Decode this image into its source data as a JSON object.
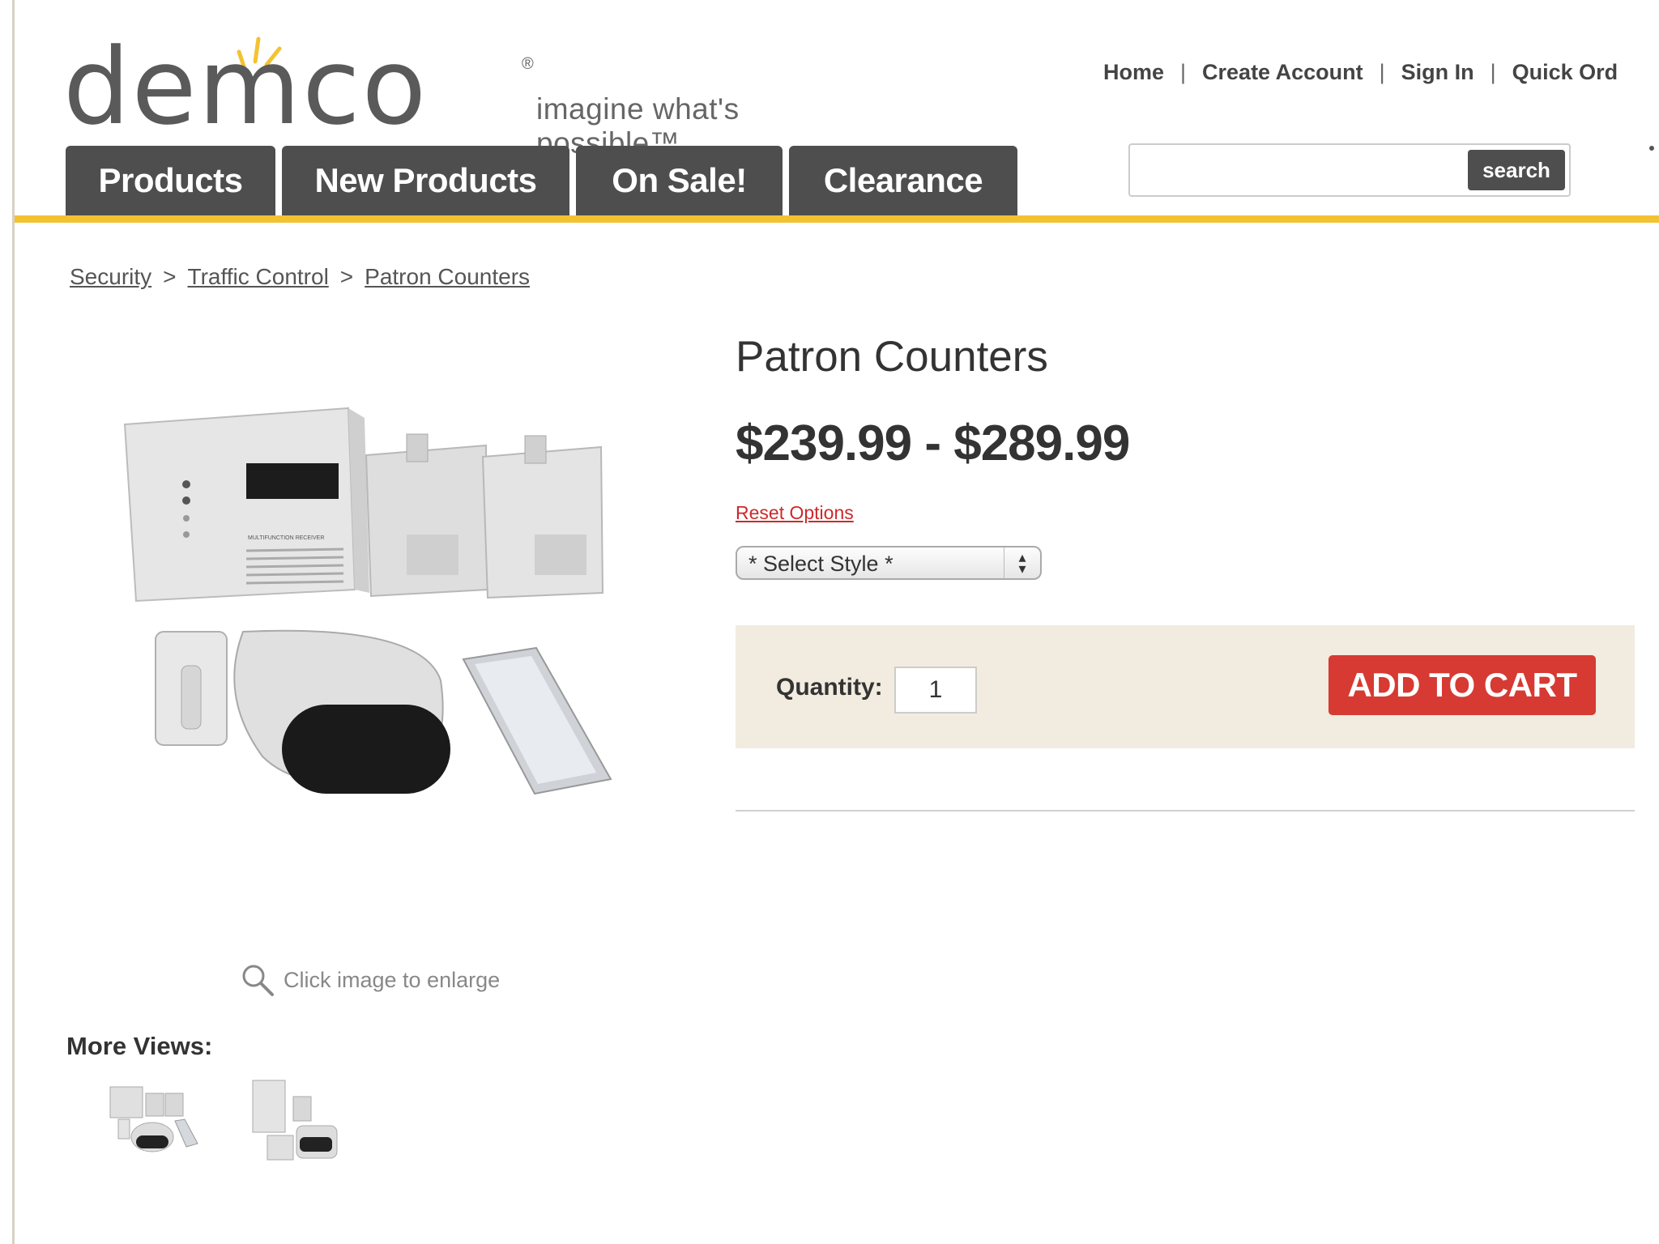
{
  "brand": {
    "wordmark": "demco",
    "registered": "®",
    "tagline": "imagine what's possible™",
    "accent": "#f3c233"
  },
  "toplinks": [
    "Home",
    "Create Account",
    "Sign In",
    "Quick Ord"
  ],
  "nav": [
    "Products",
    "New Products",
    "On Sale!",
    "Clearance"
  ],
  "search": {
    "placeholder": "",
    "button": "search"
  },
  "breadcrumb": [
    "Security",
    "Traffic Control",
    "Patron Counters"
  ],
  "product": {
    "title": "Patron Counters",
    "price": "$239.99 - $289.99",
    "reset": "Reset Options",
    "select_label": "* Select Style *",
    "quantity_label": "Quantity:",
    "quantity_value": "1",
    "add_to_cart": "ADD TO CART",
    "enlarge_hint": "Click image to enlarge",
    "more_views": "More Views:",
    "device_label": "MULTIFUNCTION RECEIVER"
  },
  "colors": {
    "nav_bg": "#4e4e4e",
    "cart_bg": "#f2ebdf",
    "cart_button": "#d63a32",
    "reset_link": "#cc2a2a"
  }
}
